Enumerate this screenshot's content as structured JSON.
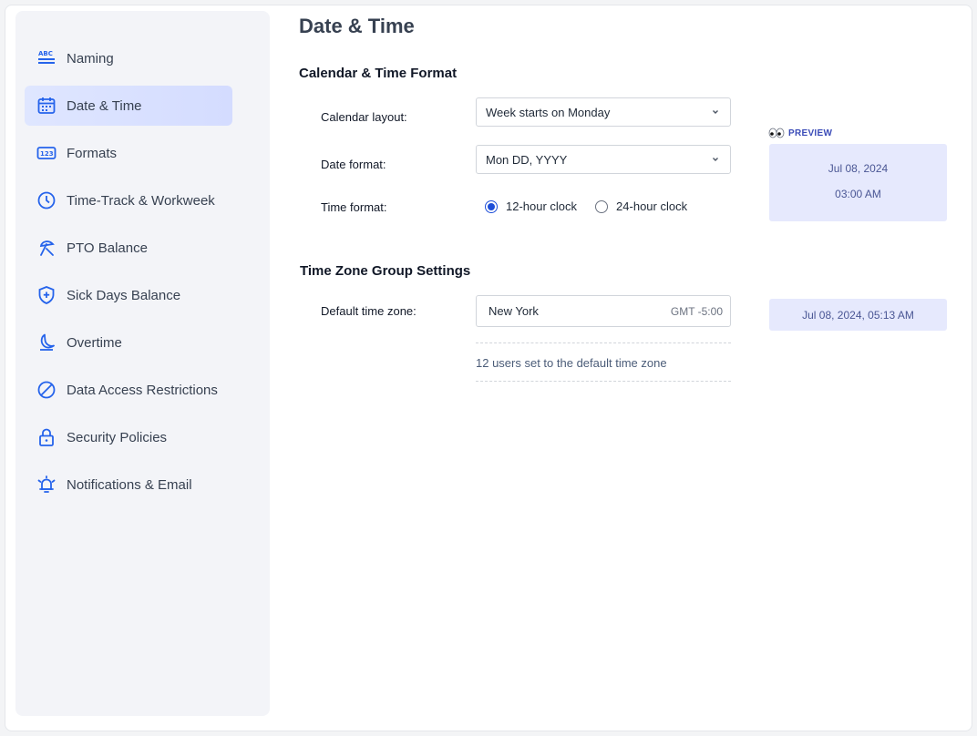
{
  "page": {
    "title": "Date & Time"
  },
  "colors": {
    "accent": "#1d4ed8",
    "active_nav_bg": "#d4dcff",
    "preview_bg": "#e6e9fd"
  },
  "sidebar": {
    "active": "Date & Time",
    "items": [
      {
        "label": "Naming",
        "icon": "abc-list-icon"
      },
      {
        "label": "Date & Time",
        "icon": "calendar-icon"
      },
      {
        "label": "Formats",
        "icon": "number-format-icon"
      },
      {
        "label": "Time-Track & Workweek",
        "icon": "clock-icon"
      },
      {
        "label": "PTO Balance",
        "icon": "beach-umbrella-icon"
      },
      {
        "label": "Sick Days Balance",
        "icon": "medical-shield-icon"
      },
      {
        "label": "Overtime",
        "icon": "moon-icon"
      },
      {
        "label": "Data Access Restrictions",
        "icon": "prohibited-icon"
      },
      {
        "label": "Security Policies",
        "icon": "lock-icon"
      },
      {
        "label": "Notifications & Email",
        "icon": "alarm-bell-icon"
      }
    ]
  },
  "calendar_section": {
    "title": "Calendar & Time Format",
    "calendar_layout": {
      "label": "Calendar layout:",
      "value": "Week starts on Monday"
    },
    "date_format": {
      "label": "Date format:",
      "value": "Mon DD, YYYY"
    },
    "time_format": {
      "label": "Time format:",
      "options": [
        {
          "label": "12-hour clock",
          "selected": true
        },
        {
          "label": "24-hour clock",
          "selected": false
        }
      ]
    },
    "preview": {
      "label": "PREVIEW",
      "date": "Jul 08, 2024",
      "time": "03:00 AM"
    }
  },
  "timezone_section": {
    "title": "Time Zone Group Settings",
    "default_tz": {
      "label": "Default time zone:",
      "city": "New York",
      "offset": "GMT -5:00"
    },
    "users_note": "12 users set to the default time zone",
    "preview": "Jul 08, 2024, 05:13 AM"
  }
}
